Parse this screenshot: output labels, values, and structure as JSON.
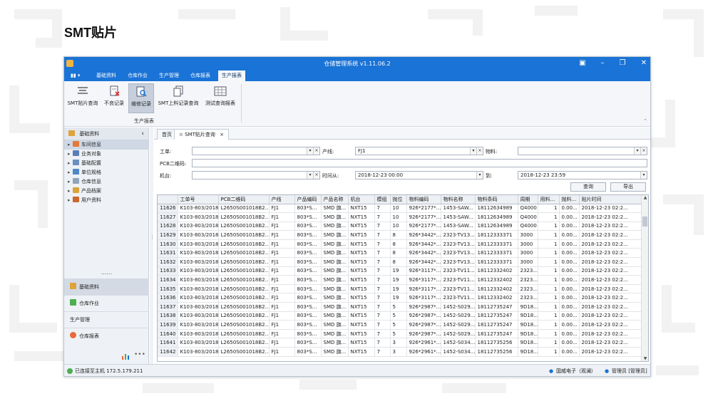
{
  "slide": {
    "title": "SMT贴片"
  },
  "window": {
    "title": "仓储管理系统 v1.11.06.2"
  },
  "menu": {
    "tabs": [
      {
        "label": "基础资料"
      },
      {
        "label": "仓库作业"
      },
      {
        "label": "生产管理"
      },
      {
        "label": "仓库报表"
      },
      {
        "label": "生产报表"
      }
    ],
    "active": "生产报表"
  },
  "ribbon": {
    "buttons": [
      {
        "label": "SMT贴片查询",
        "icon": "list-icon"
      },
      {
        "label": "不良记录",
        "icon": "defect-doc-icon"
      },
      {
        "label": "维修记录",
        "icon": "repair-search-icon",
        "selected": true
      },
      {
        "label": "SMT上料记录查询",
        "icon": "copy-doc-icon"
      },
      {
        "label": "测试查询报表",
        "icon": "table-icon"
      }
    ],
    "group_label": "生产报表"
  },
  "nav": {
    "header": "基础资料",
    "tree": [
      {
        "label": "车间信息",
        "selected": true,
        "icon_color": "#e07b39"
      },
      {
        "label": "业务对象",
        "icon_color": "#5a7db5"
      },
      {
        "label": "基础配置",
        "icon_color": "#6b8fbf"
      },
      {
        "label": "单位规格",
        "icon_color": "#4f87c8"
      },
      {
        "label": "仓库信息",
        "icon_color": "#8fa3bb"
      },
      {
        "label": "产品档案",
        "icon_color": "#d9a43a"
      },
      {
        "label": "用户资料",
        "icon_color": "#c9682f"
      }
    ],
    "dots": "......",
    "categories": [
      {
        "label": "基础资料",
        "selected": true,
        "icon_color": "#e0a33a"
      },
      {
        "label": "仓库作业",
        "icon_color": "#4caf50"
      },
      {
        "label": "生产管理",
        "icon_color": ""
      },
      {
        "label": "仓库报表",
        "icon_color": "#e8693a"
      }
    ],
    "footer_more": "•••"
  },
  "doc_tabs": [
    {
      "label": "首页"
    },
    {
      "label": "SMT贴片查询",
      "close": "×"
    }
  ],
  "filters": {
    "work_order_label": "工单:",
    "work_order_value": "",
    "line_label": "产线:",
    "line_value": "FJ1",
    "material_label": "物料:",
    "material_value": "",
    "pcb_label": "PCB二维码:",
    "pcb_value": "",
    "machine_label": "机台:",
    "machine_value": "",
    "time_from_label": "时间从:",
    "time_from_value": "2018-12-23 00:00",
    "time_to_label": "到:",
    "time_to_value": "2018-12-23 23:59",
    "query_button": "查询",
    "export_button": "导出",
    "clear_glyph": "×",
    "dropdown_glyph": "▾"
  },
  "table": {
    "columns": [
      "",
      "工单号",
      "PCB二维码",
      "产线",
      "产品编码",
      "产品名称",
      "机台",
      "模组",
      "抛位",
      "物料编码",
      "物料名称",
      "物料条码",
      "周期",
      "用料...",
      "抛料...",
      "贴片时间"
    ],
    "rows": [
      [
        "11626",
        "K103-803/2018",
        "L2650S001018B2...",
        "FJ1",
        "803*S...",
        "SMD 旗...",
        "NXT15",
        "7",
        "10",
        "926*2177*...",
        "1453-SAW...",
        "18112634989",
        "Q4000",
        "1",
        "0.00...",
        "2018-12-23 02:2..."
      ],
      [
        "11627",
        "K103-803/2018",
        "L2650S001018B2...",
        "FJ1",
        "803*S...",
        "SMD 旗...",
        "NXT15",
        "7",
        "10",
        "926*2177*...",
        "1453-SAW...",
        "18112634989",
        "Q4000",
        "1",
        "0.00...",
        "2018-12-23 02:2..."
      ],
      [
        "11628",
        "K103-803/2018",
        "L2650S001018B2...",
        "FJ1",
        "803*S...",
        "SMD 旗...",
        "NXT15",
        "7",
        "10",
        "926*2177*...",
        "1453-SAW...",
        "18112634989",
        "Q4000",
        "1",
        "0.00...",
        "2018-12-23 02:2..."
      ],
      [
        "11629",
        "K103-803/2018",
        "L2650S001018B2...",
        "FJ1",
        "803*S...",
        "SMD 旗...",
        "NXT15",
        "7",
        "8",
        "926*3442*...",
        "2323-TV13...",
        "18112333371",
        "3000",
        "1",
        "0.00...",
        "2018-12-23 02:2..."
      ],
      [
        "11630",
        "K103-803/2018",
        "L2650S001018B2...",
        "FJ1",
        "803*S...",
        "SMD 旗...",
        "NXT15",
        "7",
        "8",
        "926*3442*...",
        "2323-TV13...",
        "18112333371",
        "3000",
        "1",
        "0.00...",
        "2018-12-23 02:2..."
      ],
      [
        "11631",
        "K103-803/2018",
        "L2650S001018B2...",
        "FJ1",
        "803*S...",
        "SMD 旗...",
        "NXT15",
        "7",
        "8",
        "926*3442*...",
        "2323-TV13...",
        "18112333371",
        "3000",
        "1",
        "0.00...",
        "2018-12-23 02:2..."
      ],
      [
        "11632",
        "K103-803/2018",
        "L2650S001018B2...",
        "FJ1",
        "803*S...",
        "SMD 旗...",
        "NXT15",
        "7",
        "8",
        "926*3442*...",
        "2323-TV13...",
        "18112333371",
        "3000",
        "1",
        "0.00...",
        "2018-12-23 02:2..."
      ],
      [
        "11633",
        "K103-803/2018",
        "L2650S001018B2...",
        "FJ1",
        "803*S...",
        "SMD 旗...",
        "NXT15",
        "7",
        "19",
        "926*3117*...",
        "2323-TV11...",
        "18112332402",
        "2323...",
        "1",
        "0.00...",
        "2018-12-23 02:2..."
      ],
      [
        "11634",
        "K103-803/2018",
        "L2650S001018B2...",
        "FJ1",
        "803*S...",
        "SMD 旗...",
        "NXT15",
        "7",
        "19",
        "926*3117*...",
        "2323-TV11...",
        "18112332402",
        "2323...",
        "1",
        "0.00...",
        "2018-12-23 02:2..."
      ],
      [
        "11635",
        "K103-803/2018",
        "L2650S001018B2...",
        "FJ1",
        "803*S...",
        "SMD 旗...",
        "NXT15",
        "7",
        "19",
        "926*3117*...",
        "2323-TV11...",
        "18112332402",
        "2323...",
        "1",
        "0.00...",
        "2018-12-23 02:2..."
      ],
      [
        "11636",
        "K103-803/2018",
        "L2650S001018B2...",
        "FJ1",
        "803*S...",
        "SMD 旗...",
        "NXT15",
        "7",
        "19",
        "926*3117*...",
        "2323-TV11...",
        "18112332402",
        "2323...",
        "1",
        "0.00...",
        "2018-12-23 02:2..."
      ],
      [
        "11637",
        "K103-803/2018",
        "L2650S001018B2...",
        "FJ1",
        "803*S...",
        "SMD 旗...",
        "NXT15",
        "7",
        "5",
        "926*2987*...",
        "1452-S029...",
        "18112735247",
        "9D18...",
        "1",
        "0.00...",
        "2018-12-23 02:2..."
      ],
      [
        "11638",
        "K103-803/2018",
        "L2650S001018B2...",
        "FJ1",
        "803*S...",
        "SMD 旗...",
        "NXT15",
        "7",
        "5",
        "926*2987*...",
        "1452-S029...",
        "18112735247",
        "9D18...",
        "1",
        "0.00...",
        "2018-12-23 02:2..."
      ],
      [
        "11639",
        "K103-803/2018",
        "L2650S001018B2...",
        "FJ1",
        "803*S...",
        "SMD 旗...",
        "NXT15",
        "7",
        "5",
        "926*2987*...",
        "1452-S029...",
        "18112735247",
        "9D18...",
        "1",
        "0.00...",
        "2018-12-23 02:2..."
      ],
      [
        "11640",
        "K103-803/2018",
        "L2650S001018B2...",
        "FJ1",
        "803*S...",
        "SMD 旗...",
        "NXT15",
        "7",
        "5",
        "926*2987*...",
        "1452-S029...",
        "18112735247",
        "9D18...",
        "1",
        "0.00...",
        "2018-12-23 02:2..."
      ],
      [
        "11641",
        "K103-803/2018",
        "L2650S001018B2...",
        "FJ1",
        "803*S...",
        "SMD 旗...",
        "NXT15",
        "7",
        "3",
        "926*2961*...",
        "1452-S034...",
        "18112735256",
        "9D18...",
        "1",
        "0.00...",
        "2018-12-23 02:2..."
      ],
      [
        "11642",
        "K103-803/2018",
        "L2650S001018B2...",
        "FJ1",
        "803*S...",
        "SMD 旗...",
        "NXT15",
        "7",
        "3",
        "926*2961*...",
        "1452-S034...",
        "18112735256",
        "9D18...",
        "1",
        "0.00...",
        "2018-12-23 02:2..."
      ]
    ]
  },
  "status": {
    "connection": "已连接至主机 172.5.179.211",
    "company": "国威电子（观澜）",
    "user": "管理员 [管理员]"
  },
  "colors": {
    "titlebar": "#1a73d6",
    "ribbon_bg": "#f4f6f9"
  }
}
